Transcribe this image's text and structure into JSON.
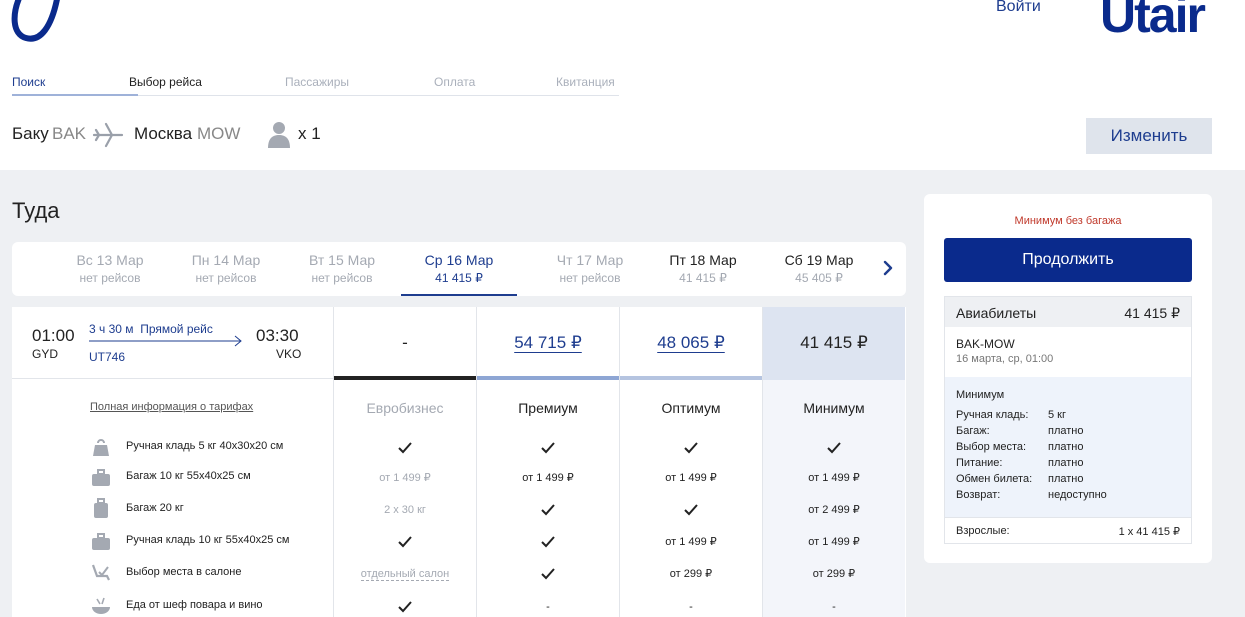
{
  "header": {
    "login": "Войти",
    "brand": "Utair"
  },
  "steps": [
    "Поиск",
    "Выбор рейса",
    "Пассажиры",
    "Оплата",
    "Квитанция"
  ],
  "route": {
    "from_city": "Баку",
    "from_code": "BAK",
    "to_city": "Москва",
    "to_code": "MOW",
    "passengers": "x 1",
    "change_label": "Изменить"
  },
  "direction_title": "Туда",
  "dates": [
    {
      "day": "Вс 13 Мар",
      "price": "нет рейсов"
    },
    {
      "day": "Пн 14 Мар",
      "price": "нет рейсов"
    },
    {
      "day": "Вт 15 Мар",
      "price": "нет рейсов"
    },
    {
      "day": "Ср 16 Мар",
      "price": "41 415 ₽"
    },
    {
      "day": "Чт 17 Мар",
      "price": "нет рейсов"
    },
    {
      "day": "Пт 18 Мар",
      "price": "41 415 ₽"
    },
    {
      "day": "Сб 19 Мар",
      "price": "45 405 ₽"
    }
  ],
  "flight": {
    "dep_time": "01:00",
    "dep_code": "GYD",
    "duration": "3 ч 30 м",
    "type": "Прямой рейс",
    "number": "UT746",
    "arr_time": "03:30",
    "arr_code": "VKO"
  },
  "tariffs": [
    {
      "name": "Евробизнес",
      "price": "-"
    },
    {
      "name": "Премиум",
      "price": "54 715 ₽"
    },
    {
      "name": "Оптимум",
      "price": "48 065 ₽"
    },
    {
      "name": "Минимум",
      "price": "41 415 ₽"
    }
  ],
  "full_info_link": "Полная информация о тарифах",
  "features": [
    {
      "label": "Ручная кладь 5 кг 40x30x20 см",
      "icon": "handbag-icon",
      "cells": [
        "check",
        "check",
        "check",
        "check"
      ]
    },
    {
      "label": "Багаж 10 кг 55x40x25 см",
      "icon": "suitcase-icon",
      "cells": [
        "от 1 499 ₽",
        "от 1 499 ₽",
        "от 1 499 ₽",
        "от 1 499 ₽"
      ]
    },
    {
      "label": "Багаж 20 кг",
      "icon": "luggage-icon",
      "cells": [
        "2 х 30 кг",
        "check",
        "check",
        "от 2 499 ₽"
      ]
    },
    {
      "label": "Ручная кладь 10 кг 55x40x25 см",
      "icon": "suitcase-icon",
      "cells": [
        "check",
        "check",
        "от 1 499 ₽",
        "от 1 499 ₽"
      ]
    },
    {
      "label": "Выбор места в салоне",
      "icon": "seat-icon",
      "cells": [
        "отдельный салон",
        "check",
        "от 299 ₽",
        "от 299 ₽"
      ]
    },
    {
      "label": "Еда от шеф повара и вино",
      "icon": "food-icon",
      "cells": [
        "check",
        "-",
        "-",
        "-"
      ]
    }
  ],
  "panel": {
    "warning": "Минимум без багажа",
    "continue_label": "Продолжить",
    "tickets_label": "Авиабилеты",
    "tickets_total": "41 415 ₽",
    "route": "BAK-MOW",
    "date": "16 марта, ср, 01:00",
    "tariff_name": "Минимум",
    "rows": [
      {
        "k": "Ручная кладь:",
        "v": "5 кг"
      },
      {
        "k": "Багаж:",
        "v": "платно"
      },
      {
        "k": "Выбор места:",
        "v": "платно"
      },
      {
        "k": "Питание:",
        "v": "платно"
      },
      {
        "k": "Обмен билета:",
        "v": "платно"
      },
      {
        "k": "Возврат:",
        "v": "недоступно"
      }
    ],
    "adults_label": "Взрослые:",
    "adults_value": "1 х 41 415 ₽"
  },
  "colors": {
    "brand": "#0a2a8c",
    "link": "#1e3d8f",
    "warning": "#c0392b",
    "background": "#eef0f3"
  }
}
